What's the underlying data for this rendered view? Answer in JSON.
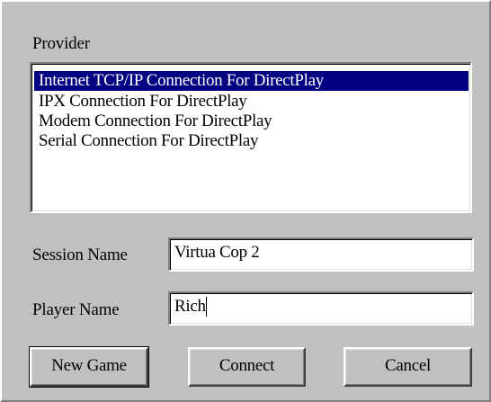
{
  "provider": {
    "label": "Provider",
    "items": [
      {
        "label": "Internet TCP/IP Connection For DirectPlay",
        "selected": true
      },
      {
        "label": "IPX Connection For DirectPlay",
        "selected": false
      },
      {
        "label": "Modem Connection For DirectPlay",
        "selected": false
      },
      {
        "label": "Serial Connection For DirectPlay",
        "selected": false
      }
    ]
  },
  "session": {
    "label": "Session Name",
    "value": "Virtua Cop 2"
  },
  "player": {
    "label": "Player Name",
    "value": "Rich"
  },
  "buttons": {
    "new_game": "New Game",
    "connect": "Connect",
    "cancel": "Cancel"
  },
  "colors": {
    "dialog_bg": "#c0c0c0",
    "selection_bg": "#000080",
    "selection_fg": "#ffffff"
  }
}
